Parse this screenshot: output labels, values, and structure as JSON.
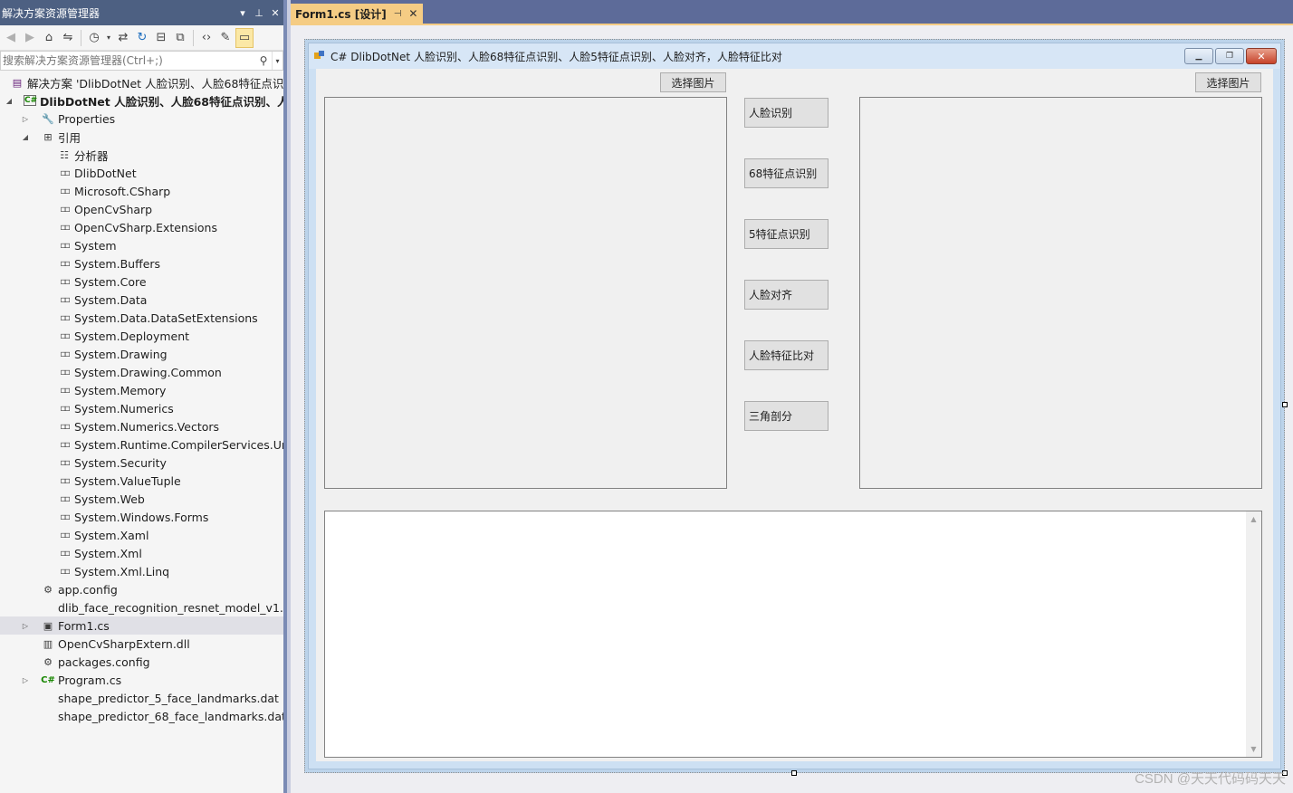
{
  "solution_explorer": {
    "title": "解决方案资源管理器",
    "title_controls": {
      "dropdown": "▾",
      "pin": "⊥",
      "close": "✕"
    },
    "search_placeholder": "搜索解决方案资源管理器(Ctrl+;)",
    "tree": [
      {
        "label": "解决方案 'DlibDotNet 人脸识别、人脸68特征点识别",
        "icon": "solution-icon",
        "level": 0
      },
      {
        "label": "DlibDotNet 人脸识别、人脸68特征点识别、人脸5",
        "icon": "csharp-project-icon",
        "level": 0,
        "expander": "expanded",
        "bold": true
      },
      {
        "label": "Properties",
        "icon": "wrench-icon",
        "level": 1,
        "expander": "collapsed"
      },
      {
        "label": "引用",
        "icon": "references-icon",
        "level": 1,
        "expander": "expanded"
      },
      {
        "label": "分析器",
        "icon": "analyzer-icon",
        "level": 2
      },
      {
        "label": "DlibDotNet",
        "icon": "reference-icon",
        "level": 2
      },
      {
        "label": "Microsoft.CSharp",
        "icon": "reference-icon",
        "level": 2
      },
      {
        "label": "OpenCvSharp",
        "icon": "reference-icon",
        "level": 2
      },
      {
        "label": "OpenCvSharp.Extensions",
        "icon": "reference-icon",
        "level": 2
      },
      {
        "label": "System",
        "icon": "reference-icon",
        "level": 2
      },
      {
        "label": "System.Buffers",
        "icon": "reference-icon",
        "level": 2
      },
      {
        "label": "System.Core",
        "icon": "reference-icon",
        "level": 2
      },
      {
        "label": "System.Data",
        "icon": "reference-icon",
        "level": 2
      },
      {
        "label": "System.Data.DataSetExtensions",
        "icon": "reference-icon",
        "level": 2
      },
      {
        "label": "System.Deployment",
        "icon": "reference-icon",
        "level": 2
      },
      {
        "label": "System.Drawing",
        "icon": "reference-icon",
        "level": 2
      },
      {
        "label": "System.Drawing.Common",
        "icon": "reference-icon",
        "level": 2
      },
      {
        "label": "System.Memory",
        "icon": "reference-icon",
        "level": 2
      },
      {
        "label": "System.Numerics",
        "icon": "reference-icon",
        "level": 2
      },
      {
        "label": "System.Numerics.Vectors",
        "icon": "reference-icon",
        "level": 2
      },
      {
        "label": "System.Runtime.CompilerServices.Unsaf",
        "icon": "reference-icon",
        "level": 2
      },
      {
        "label": "System.Security",
        "icon": "reference-icon",
        "level": 2
      },
      {
        "label": "System.ValueTuple",
        "icon": "reference-icon",
        "level": 2
      },
      {
        "label": "System.Web",
        "icon": "reference-icon",
        "level": 2
      },
      {
        "label": "System.Windows.Forms",
        "icon": "reference-icon",
        "level": 2
      },
      {
        "label": "System.Xaml",
        "icon": "reference-icon",
        "level": 2
      },
      {
        "label": "System.Xml",
        "icon": "reference-icon",
        "level": 2
      },
      {
        "label": "System.Xml.Linq",
        "icon": "reference-icon",
        "level": 2
      },
      {
        "label": "app.config",
        "icon": "config-icon",
        "level": 1
      },
      {
        "label": "dlib_face_recognition_resnet_model_v1.dat",
        "icon": "none",
        "level": 1
      },
      {
        "label": "Form1.cs",
        "icon": "form-icon",
        "level": 1,
        "expander": "collapsed",
        "selected": true
      },
      {
        "label": "OpenCvSharpExtern.dll",
        "icon": "library-icon",
        "level": 1
      },
      {
        "label": "packages.config",
        "icon": "config-icon",
        "level": 1
      },
      {
        "label": "Program.cs",
        "icon": "csharp-file-icon",
        "level": 1,
        "expander": "collapsed"
      },
      {
        "label": "shape_predictor_5_face_landmarks.dat",
        "icon": "none",
        "level": 1
      },
      {
        "label": "shape_predictor_68_face_landmarks.dat",
        "icon": "none",
        "level": 1
      }
    ]
  },
  "document_tab": {
    "label": "Form1.cs [设计]",
    "pin": "⊣",
    "close": "✕"
  },
  "form": {
    "title": "C# DlibDotNet 人脸识别、人脸68特征点识别、人脸5特征点识别、人脸对齐，人脸特征比对",
    "window_buttons": {
      "minimize": "▁",
      "restore": "❐",
      "close": "✕"
    },
    "select_image_left": "选择图片",
    "select_image_right": "选择图片",
    "actions": [
      "人脸识别",
      "68特征点识别",
      "5特征点识别",
      "人脸对齐",
      "人脸特征比对",
      "三角剖分"
    ]
  },
  "watermark": "CSDN @天天代码码天天",
  "colors": {
    "title_bar": "#4d6082",
    "doc_tab_active": "#f5cc84",
    "doc_band": "#5d6b99",
    "form_frame": "#cde0f3",
    "control_face": "#e1e1e1"
  }
}
